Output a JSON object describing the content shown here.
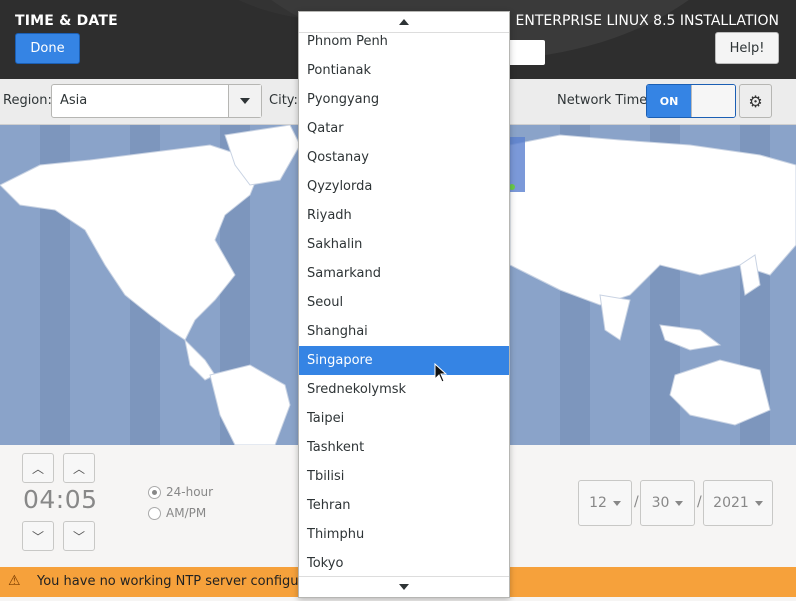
{
  "header": {
    "spoke_title": "TIME & DATE",
    "product_title": "ENTERPRISE LINUX 8.5 INSTALLATION",
    "done_label": "Done",
    "help_label": "Help!"
  },
  "toolbar": {
    "region_label": "Region:",
    "region_value": "Asia",
    "city_label": "City:",
    "network_time_label": "Network Time",
    "network_time_state": "ON"
  },
  "city_list": {
    "items": [
      "Phnom Penh",
      "Pontianak",
      "Pyongyang",
      "Qatar",
      "Qostanay",
      "Qyzylorda",
      "Riyadh",
      "Sakhalin",
      "Samarkand",
      "Seoul",
      "Shanghai",
      "Singapore",
      "Srednekolymsk",
      "Taipei",
      "Tashkent",
      "Tbilisi",
      "Tehran",
      "Thimphu",
      "Tokyo"
    ],
    "selected": "Singapore"
  },
  "time": {
    "value": "04:05",
    "format_24": "24-hour",
    "format_ampm": "AM/PM",
    "selected_format": "24-hour"
  },
  "date": {
    "month": "12",
    "day": "30",
    "year": "2021",
    "separator": "/"
  },
  "warning": {
    "text": "You have no working NTP server configured"
  },
  "colors": {
    "accent": "#3584e4",
    "warning": "#f6a13b",
    "header_bg": "#2e2e2e"
  }
}
